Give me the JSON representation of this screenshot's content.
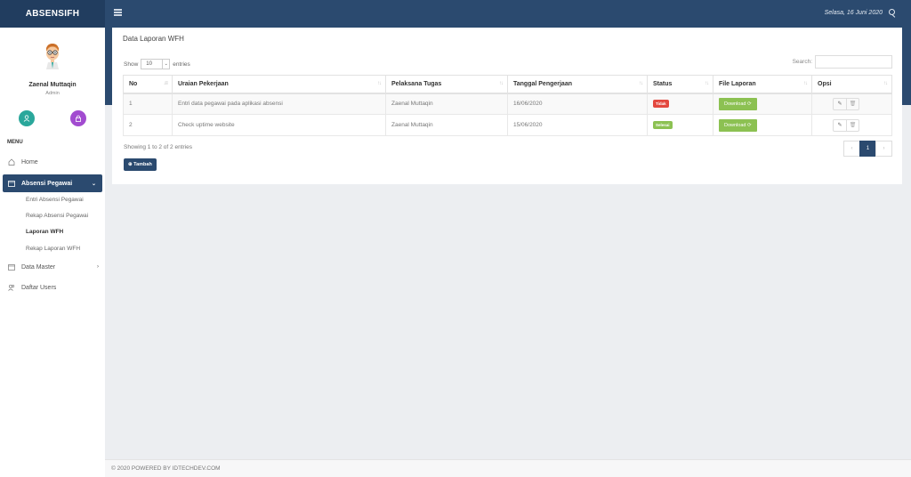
{
  "app": {
    "brand": "ABSENSIFH"
  },
  "header": {
    "date": "Selasa, 16 Juni 2020",
    "user_icon": "user-icon",
    "toggle_icon": "menu-toggle-icon"
  },
  "sidebar": {
    "user": {
      "name": "Zaenal Muttaqin",
      "role": "Admin"
    },
    "quick_buttons": [
      {
        "icon": "user-icon",
        "color": "#2aa79b"
      },
      {
        "icon": "lock-icon",
        "color": "#a24bd0"
      }
    ],
    "menu_heading": "MENU",
    "items": [
      {
        "label": "Home",
        "icon": "home-icon"
      },
      {
        "label": "Absensi Pegawai",
        "icon": "folder-icon",
        "active": true
      },
      {
        "label": "Data Master",
        "icon": "folder-icon"
      },
      {
        "label": "Daftar Users",
        "icon": "users-icon"
      }
    ],
    "subitems": [
      {
        "label": "Entri Absensi Pegawai"
      },
      {
        "label": "Rekap Absensi Pegawai"
      },
      {
        "label": "Laporan WFH",
        "current": true
      },
      {
        "label": "Rekap Laporan WFH"
      }
    ]
  },
  "main": {
    "title": "Data Laporan WFH",
    "length": {
      "show": "Show",
      "value": "10",
      "entries": "entries"
    },
    "search_label": "Search:",
    "columns": [
      "No",
      "Uraian Pekerjaan",
      "Pelaksana Tugas",
      "Tanggal Pengerjaan",
      "Status",
      "File Laporan",
      "Opsi"
    ],
    "rows": [
      {
        "no": "1",
        "uraian": "Entri data pegawai pada aplikasi absensi",
        "pelaksana": "Zaenal Muttaqin",
        "tanggal": "16/06/2020",
        "status": "Tidak",
        "status_color": "#e3483f",
        "file": "Download"
      },
      {
        "no": "2",
        "uraian": "Check uptime website",
        "pelaksana": "Zaenal Muttaqin",
        "tanggal": "15/06/2020",
        "status": "Selesai",
        "status_color": "#8cc152",
        "file": "Download"
      }
    ],
    "info": "Showing 1 to 2 of 2 entries",
    "pagination": {
      "prev": "‹",
      "current": "1",
      "next": "›"
    },
    "add_button": "Tambah"
  },
  "footer": {
    "text": "© 2020 POWERED BY IDTECHDEV.COM"
  },
  "colors": {
    "primary": "#2b4a6f",
    "success": "#8cc152",
    "danger": "#e3483f"
  }
}
